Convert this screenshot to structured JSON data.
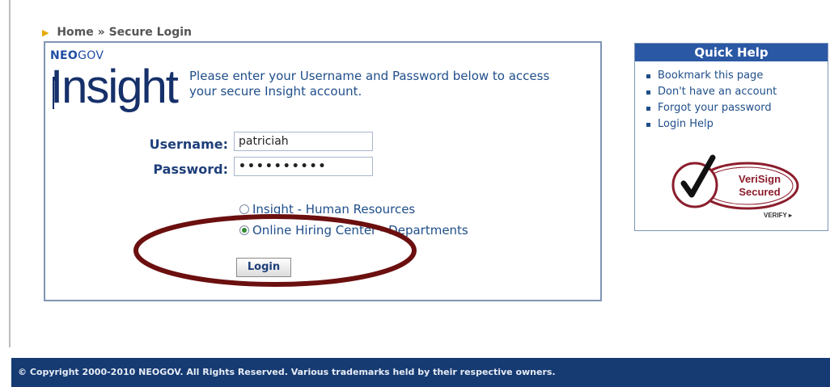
{
  "breadcrumb": {
    "home": "Home",
    "separator": "»",
    "current": "Secure Login"
  },
  "logo": {
    "neo": "NEO",
    "gov": "GOV",
    "product": "Insight"
  },
  "intro_text": "Please enter your Username and Password below to access your secure Insight account.",
  "form": {
    "username_label": "Username:",
    "username_value": "patriciah",
    "password_label": "Password:",
    "password_value": "••••••••••",
    "radio_options": [
      {
        "label": "Insight - Human Resources",
        "selected": false
      },
      {
        "label": "Online Hiring Center - Departments",
        "selected": true
      }
    ],
    "login_button": "Login"
  },
  "quick_help": {
    "title": "Quick Help",
    "links": [
      "Bookmark this page",
      "Don't have an account",
      "Forgot your password",
      "Login Help"
    ]
  },
  "verisign": {
    "line1": "VeriSign",
    "line2": "Secured",
    "verify": "VERIFY ▸"
  },
  "footer": {
    "copyright": "© Copyright 2000-2010 NEOGOV. All Rights Reserved. Various trademarks held by their respective owners."
  },
  "colors": {
    "accent": "#2b58a5",
    "footer_bg": "#163a72",
    "annotation": "#6b0f0f"
  }
}
